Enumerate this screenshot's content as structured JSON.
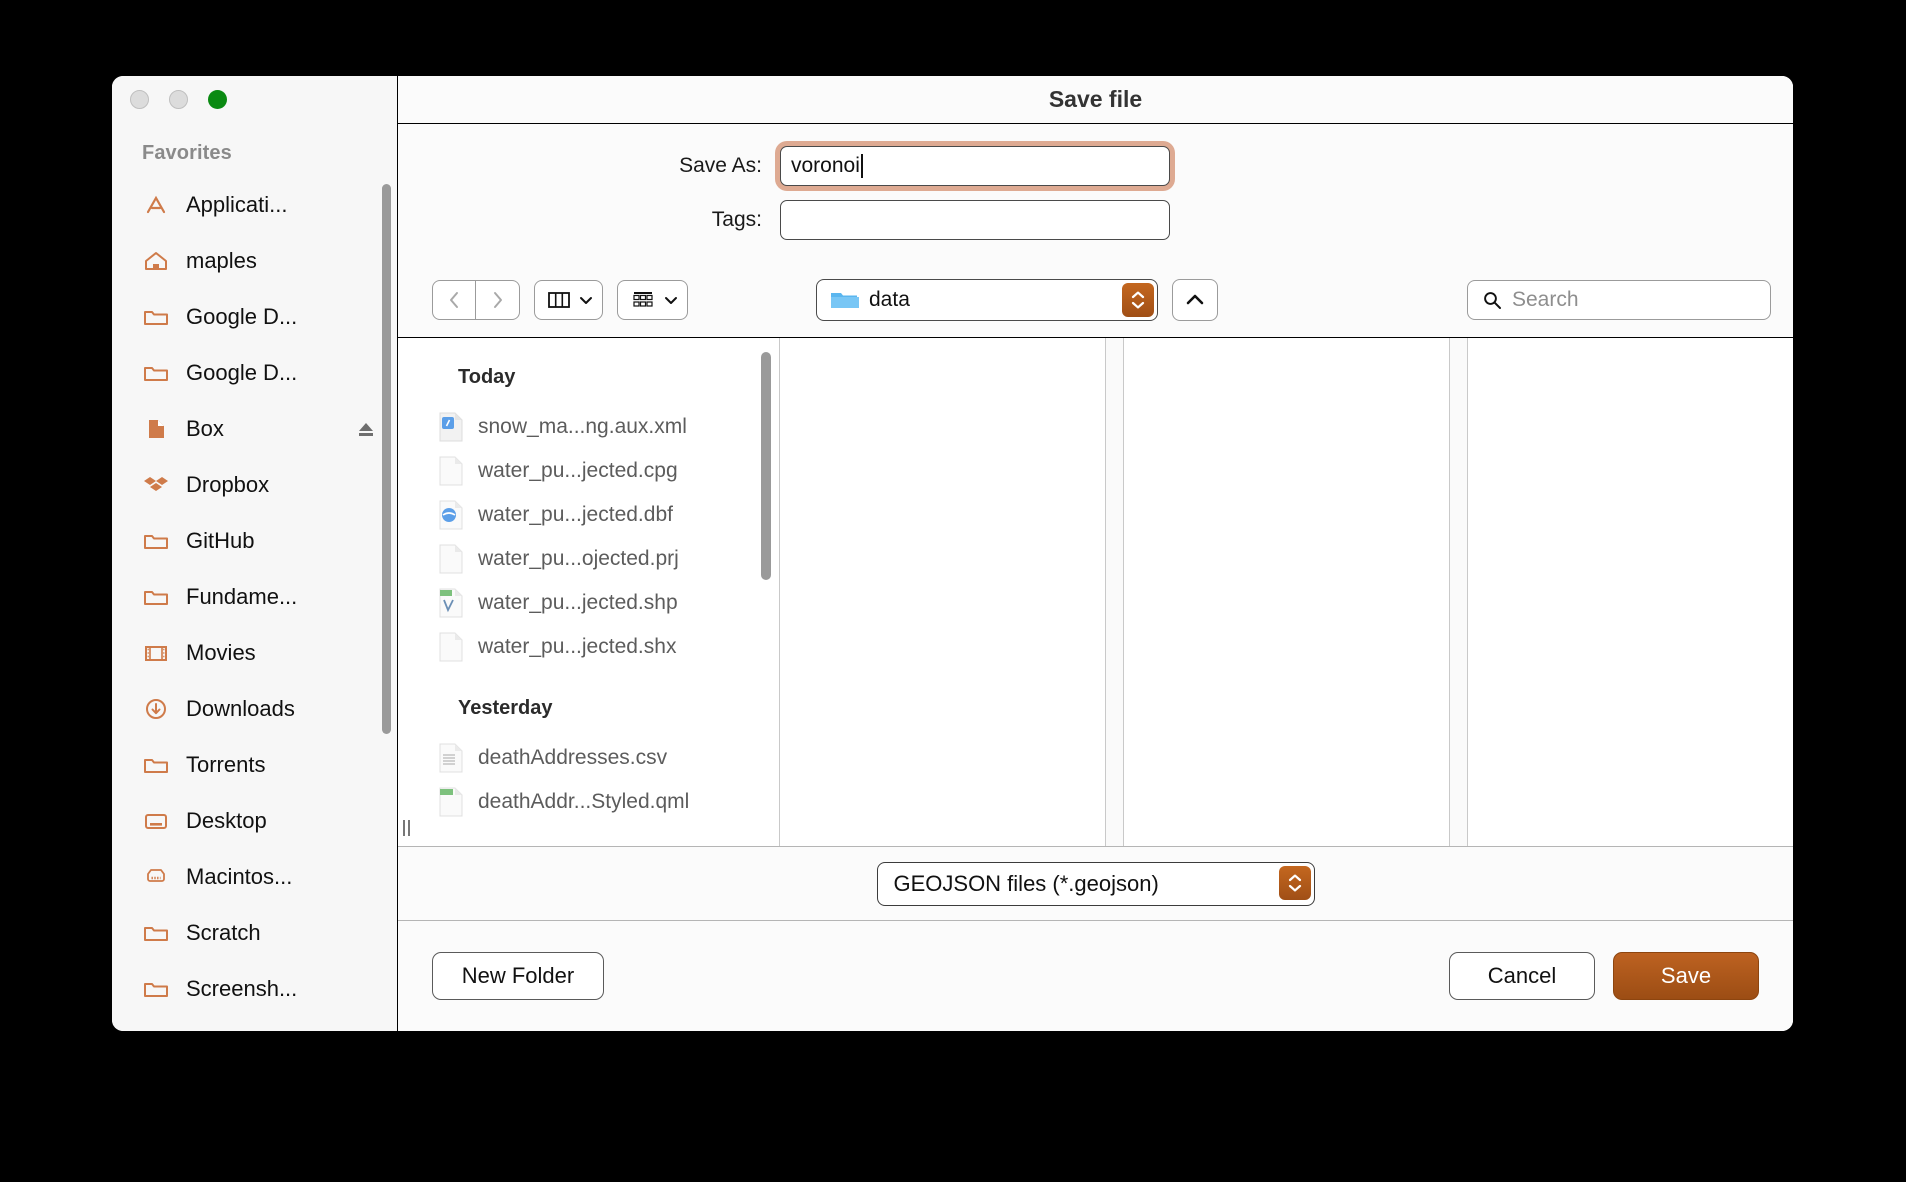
{
  "window": {
    "title": "Save file",
    "traffic_lights": [
      "close",
      "minimize",
      "zoom"
    ]
  },
  "sidebar": {
    "header": "Favorites",
    "items": [
      {
        "label": "Applicati...",
        "icon": "applications-icon",
        "eject": false
      },
      {
        "label": "maples",
        "icon": "home-icon",
        "eject": false
      },
      {
        "label": "Google D...",
        "icon": "folder-icon",
        "eject": false
      },
      {
        "label": "Google D...",
        "icon": "folder-icon",
        "eject": false
      },
      {
        "label": "Box",
        "icon": "document-icon",
        "eject": true
      },
      {
        "label": "Dropbox",
        "icon": "dropbox-icon",
        "eject": false
      },
      {
        "label": "GitHub",
        "icon": "folder-icon",
        "eject": false
      },
      {
        "label": "Fundame...",
        "icon": "folder-icon",
        "eject": false
      },
      {
        "label": "Movies",
        "icon": "film-icon",
        "eject": false
      },
      {
        "label": "Downloads",
        "icon": "download-icon",
        "eject": false
      },
      {
        "label": "Torrents",
        "icon": "folder-icon",
        "eject": false
      },
      {
        "label": "Desktop",
        "icon": "desktop-icon",
        "eject": false
      },
      {
        "label": "Macintos...",
        "icon": "harddisk-icon",
        "eject": false
      },
      {
        "label": "Scratch",
        "icon": "folder-icon",
        "eject": false
      },
      {
        "label": "Screensh...",
        "icon": "folder-icon",
        "eject": false
      }
    ]
  },
  "form": {
    "save_as_label": "Save As:",
    "save_as_value": "voronoi",
    "tags_label": "Tags:",
    "tags_value": ""
  },
  "toolbar": {
    "back_icon": "chevron-left-icon",
    "forward_icon": "chevron-right-icon",
    "view_column_icon": "column-view-icon",
    "view_gallery_icon": "gallery-view-icon",
    "path_label": "data",
    "path_icon": "blue-folder-icon",
    "up_icon": "chevron-up-icon",
    "search_placeholder": "Search",
    "search_icon": "search-icon"
  },
  "browser": {
    "groups": [
      {
        "label": "Today",
        "files": [
          {
            "name": "snow_ma...ng.aux.xml",
            "icon": "xml-file-icon"
          },
          {
            "name": "water_pu...jected.cpg",
            "icon": "blank-file-icon"
          },
          {
            "name": "water_pu...jected.dbf",
            "icon": "dbf-file-icon"
          },
          {
            "name": "water_pu...ojected.prj",
            "icon": "blank-file-icon"
          },
          {
            "name": "water_pu...jected.shp",
            "icon": "shp-file-icon"
          },
          {
            "name": "water_pu...jected.shx",
            "icon": "blank-file-icon"
          }
        ]
      },
      {
        "label": "Yesterday",
        "files": [
          {
            "name": "deathAddresses.csv",
            "icon": "csv-file-icon"
          },
          {
            "name": "deathAddr...Styled.qml",
            "icon": "qml-file-icon"
          }
        ]
      }
    ]
  },
  "filter": {
    "file_type": "GEOJSON files (*.geojson)"
  },
  "footer": {
    "new_folder": "New Folder",
    "cancel": "Cancel",
    "save": "Save"
  },
  "colors": {
    "accent": "#b05c1c",
    "sidebar_icon": "#cf7b4a",
    "focus_ring": "#cc7850",
    "green_light": "#0a8a12"
  }
}
